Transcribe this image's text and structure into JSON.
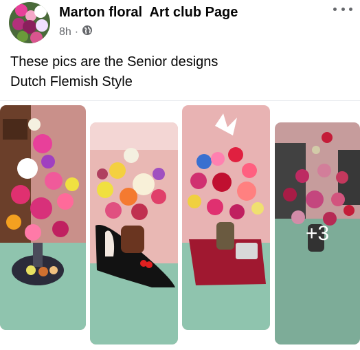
{
  "post": {
    "page_name": "Marton floral  Art club Page",
    "time": "8h",
    "separator": "·",
    "privacy_icon": "globe-icon",
    "more_icon": "more-options-icon",
    "text_line1": "These pics are the Senior designs",
    "text_line2": "Dutch Flemish Style"
  },
  "photos": {
    "more_count": "+3"
  }
}
